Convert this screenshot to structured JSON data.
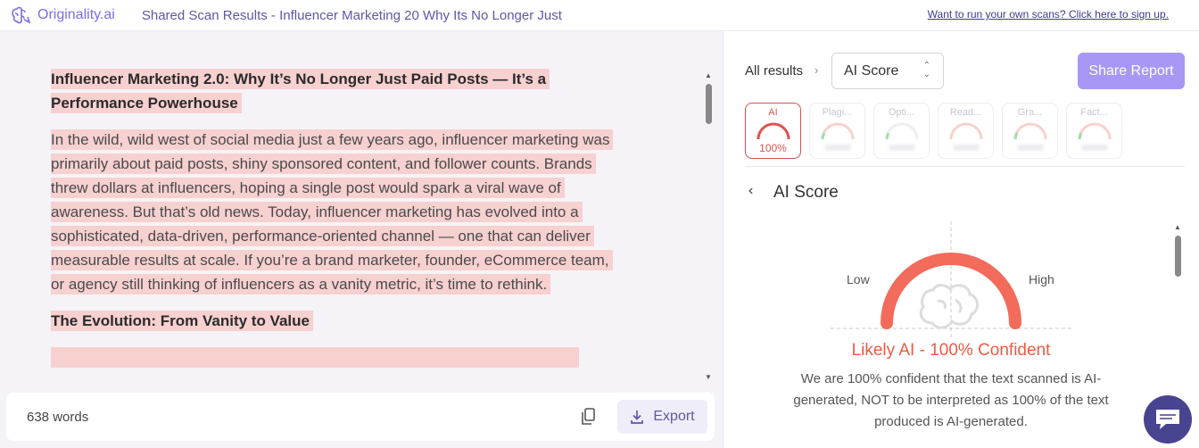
{
  "header": {
    "logo_text": "Originality.ai",
    "title": "Shared Scan Results - Influencer Marketing 20 Why Its No Longer Just",
    "signup_link": "Want to run your own scans? Click here to sign up."
  },
  "document": {
    "heading1": "Influencer Marketing 2.0: Why It’s No Longer Just Paid Posts — It’s a Performance Powerhouse",
    "paragraph1": "In the wild, wild west of social media just a few years ago, influencer marketing was primarily about paid posts, shiny sponsored content, and follower counts. Brands threw dollars at influencers, hoping a single post would spark a viral wave of awareness. But that’s old news. Today, influencer marketing has evolved into a sophisticated, data-driven, performance-oriented channel — one that can deliver measurable results at scale. If you’re a brand marketer, founder, eCommerce team, or agency still thinking of influencers as a vanity metric, it’s time to rethink.",
    "heading2": "The Evolution: From Vanity to Value",
    "highlight_color": "#f7d0d0"
  },
  "footer": {
    "word_count": "638 words",
    "export_label": "Export"
  },
  "results": {
    "all_results_label": "All results",
    "selected_view": "AI Score",
    "share_label": "Share Report",
    "tabs": [
      {
        "label": "AI",
        "score": "100%",
        "active": true
      },
      {
        "label": "Plagi...",
        "active": false
      },
      {
        "label": "Opti...",
        "active": false
      },
      {
        "label": "Read...",
        "active": false
      },
      {
        "label": "Gra...",
        "active": false
      },
      {
        "label": "Fact...",
        "active": false
      }
    ],
    "section_title": "AI Score",
    "gauge": {
      "low_label": "Low",
      "high_label": "High",
      "value_percent": 100,
      "color": "#f26b5b"
    },
    "verdict": "Likely AI - 100% Confident",
    "description": "We are 100% confident that the text scanned is AI-generated, NOT to be interpreted as 100% of the text produced is AI-generated."
  },
  "colors": {
    "brand": "#7b6ee6",
    "accent": "#a897f5",
    "ai_red": "#ef5a44"
  },
  "icons": {
    "logo": "brain-icon",
    "copy": "copy-icon",
    "export": "download-icon",
    "chat": "chat-bubble-icon"
  }
}
